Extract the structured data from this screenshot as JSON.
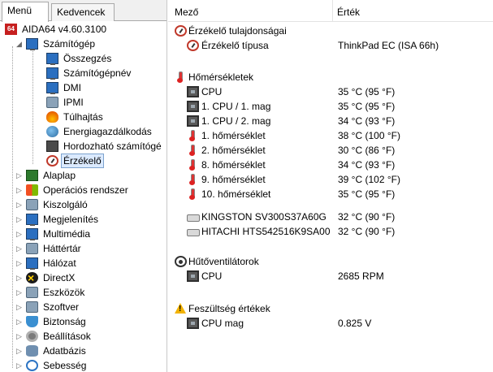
{
  "tabs": {
    "menu": "Menü",
    "favorites": "Kedvencek"
  },
  "tree": {
    "root": "AIDA64 v4.60.3100",
    "computer": "Számítógép",
    "computer_children": [
      "Összegzés",
      "Számítógépnév",
      "DMI",
      "IPMI",
      "Túlhajtás",
      "Energiagazdálkodás",
      "Hordozható számítógé",
      "Érzékelő"
    ],
    "top_items": [
      "Alaplap",
      "Operációs rendszer",
      "Kiszolgáló",
      "Megjelenítés",
      "Multimédia",
      "Háttértár",
      "Hálózat",
      "DirectX",
      "Eszközök",
      "Szoftver",
      "Biztonság",
      "Beállítások",
      "Adatbázis",
      "Sebesség"
    ]
  },
  "columns": {
    "field": "Mező",
    "value": "Érték"
  },
  "sections": {
    "sensor_props": {
      "title": "Érzékelő tulajdonságai",
      "rows": [
        {
          "name": "Érzékelő típusa",
          "value": "ThinkPad EC  (ISA 66h)"
        }
      ]
    },
    "temperatures": {
      "title": "Hőmérsékletek",
      "rows": [
        {
          "name": "CPU",
          "value": "35 °C  (95 °F)"
        },
        {
          "name": "1. CPU / 1. mag",
          "value": "35 °C  (95 °F)"
        },
        {
          "name": "1. CPU / 2. mag",
          "value": "34 °C  (93 °F)"
        },
        {
          "name": "1. hőmérséklet",
          "value": "38 °C  (100 °F)"
        },
        {
          "name": "2. hőmérséklet",
          "value": "30 °C  (86 °F)"
        },
        {
          "name": "8. hőmérséklet",
          "value": "34 °C  (93 °F)"
        },
        {
          "name": "9. hőmérséklet",
          "value": "39 °C  (102 °F)"
        },
        {
          "name": "10. hőmérséklet",
          "value": "35 °C  (95 °F)"
        },
        {
          "name": "KINGSTON SV300S37A60G",
          "value": "32 °C  (90 °F)"
        },
        {
          "name": "HITACHI HTS542516K9SA00",
          "value": "32 °C  (90 °F)"
        }
      ]
    },
    "fans": {
      "title": "Hűtőventilátorok",
      "rows": [
        {
          "name": "CPU",
          "value": "2685 RPM"
        }
      ]
    },
    "voltages": {
      "title": "Feszültség értékek",
      "rows": [
        {
          "name": "CPU mag",
          "value": "0.825 V"
        }
      ]
    }
  },
  "colors": {
    "selection_bg": "#dbeaff",
    "selection_border": "#7da2ce",
    "app_icon": "#c61f1f"
  }
}
